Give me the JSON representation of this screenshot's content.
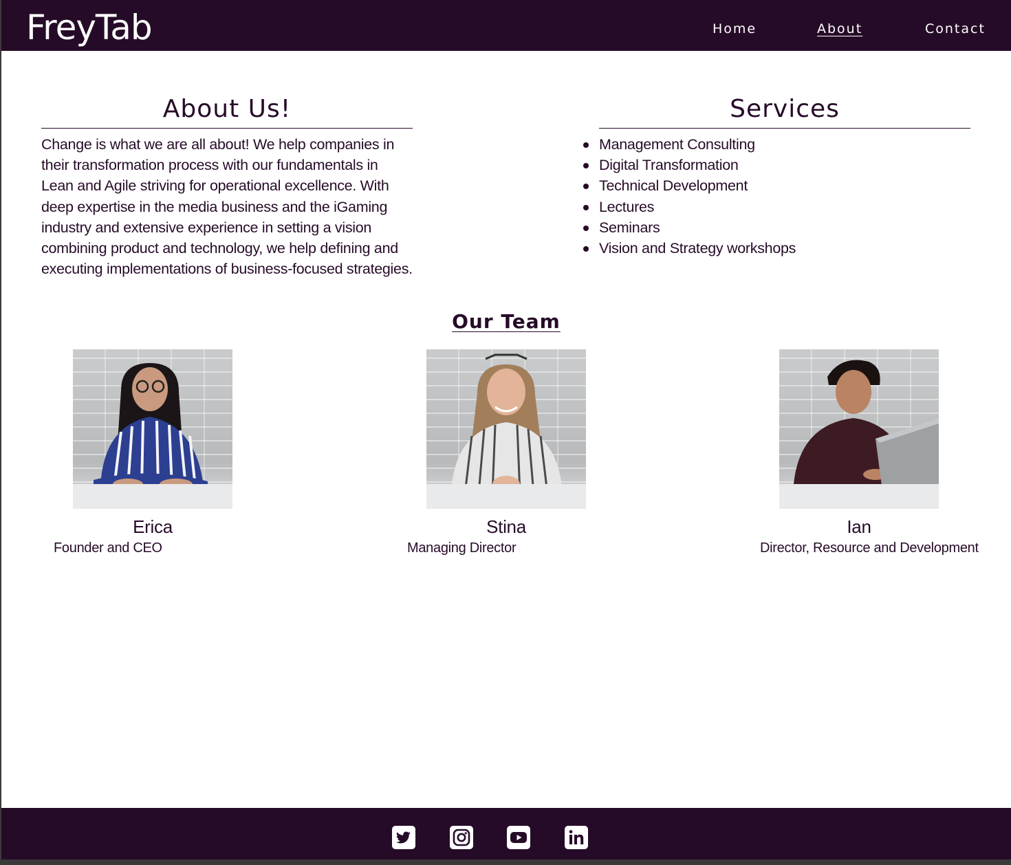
{
  "header": {
    "logo": "FreyTab",
    "nav": [
      {
        "label": "Home",
        "active": false
      },
      {
        "label": "About",
        "active": true
      },
      {
        "label": "Contact",
        "active": false
      }
    ]
  },
  "about": {
    "title": "About Us!",
    "text": "Change is what we are all about! We help companies in their transformation process with our fundamentals in Lean and Agile striving for operational excellence. With deep expertise in the media business and the iGaming industry and extensive experience in setting a vision combining product and technology, we help defining and executing implementations of business-focused strategies."
  },
  "services": {
    "title": "Services",
    "items": [
      "Management Consulting",
      "Digital Transformation",
      "Technical Development",
      "Lectures",
      "Seminars",
      "Vision and Strategy workshops"
    ]
  },
  "team": {
    "title": "Our Team",
    "members": [
      {
        "name": "Erica",
        "role": "Founder and CEO"
      },
      {
        "name": "Stina",
        "role": "Managing Director"
      },
      {
        "name": "Ian",
        "role": "Director, Resource and Development"
      }
    ]
  },
  "footer": {
    "icons": [
      "twitter-icon",
      "instagram-icon",
      "youtube-icon",
      "linkedin-icon"
    ]
  },
  "colors": {
    "brand_dark": "#260b28",
    "background": "#ffffff"
  }
}
